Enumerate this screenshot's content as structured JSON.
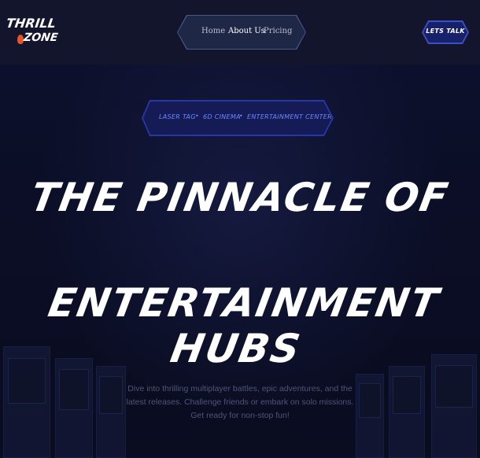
{
  "brand": {
    "logo_line1": "THRILL",
    "logo_line2": "ZONE"
  },
  "nav": {
    "items": [
      {
        "label": "Home",
        "active": false
      },
      {
        "label": "About Us",
        "active": true
      },
      {
        "label": "Pricing",
        "active": false
      }
    ]
  },
  "cta": {
    "label": "LETS TALK"
  },
  "tags": {
    "items": [
      "LASER TAG",
      "6D CINEMA",
      "ENTERTAINMENT CENTER"
    ],
    "separator": "•"
  },
  "hero": {
    "line1": "THE PINNACLE OF",
    "line2": "ENTERTAINMENT HUBS"
  },
  "description": "Dive into thrilling multiplayer battles, epic adventures, and the latest releases. Challenge friends or embark on solo missions. Get ready for non-stop fun!",
  "colors": {
    "background": "#0c0f24",
    "accent": "#3d4fc8",
    "tag_text": "#6f86ff",
    "flame": "#e8542a"
  }
}
